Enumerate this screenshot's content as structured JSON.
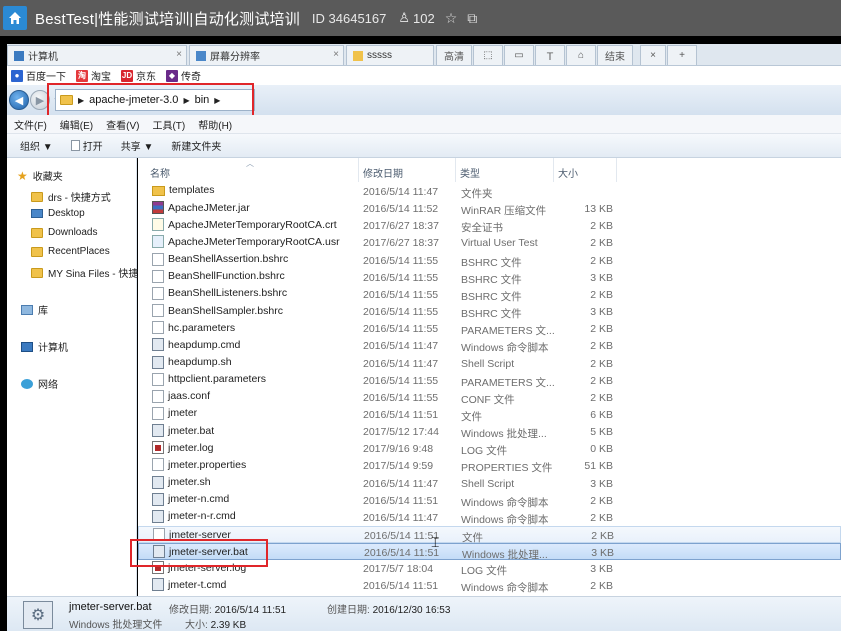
{
  "stream": {
    "title": "BestTest|性能测试培训|自动化测试培训",
    "room_id": "ID 34645167",
    "viewers": "102"
  },
  "browser": {
    "tabs": [
      {
        "label": "计算机"
      },
      {
        "label": "屏幕分辨率"
      },
      {
        "label": "sssss"
      }
    ],
    "tab_buttons": [
      "高清",
      "结束"
    ],
    "favorites": [
      "百度一下",
      "淘宝",
      "京东",
      "传奇"
    ]
  },
  "address": {
    "path": [
      "apache-jmeter-3.0",
      "bin"
    ]
  },
  "menu": [
    "文件(F)",
    "编辑(E)",
    "查看(V)",
    "工具(T)",
    "帮助(H)"
  ],
  "commands": [
    "组织 ▼",
    "打开",
    "共享 ▼",
    "新建文件夹"
  ],
  "nav": {
    "favorites_label": "收藏夹",
    "favorites": [
      "drs - 快捷方式",
      "Desktop",
      "Downloads",
      "RecentPlaces",
      "MY Sina Files - 快捷"
    ],
    "library": "库",
    "computer": "计算机",
    "network": "网络"
  },
  "columns": {
    "name": "名称",
    "date": "修改日期",
    "type": "类型",
    "size": "大小"
  },
  "files": [
    {
      "name": "templates",
      "date": "2016/5/14 11:47",
      "type": "文件夹",
      "size": "",
      "icon": "folder"
    },
    {
      "name": "ApacheJMeter.jar",
      "date": "2016/5/14 11:52",
      "type": "WinRAR 压缩文件",
      "size": "13 KB",
      "icon": "jar"
    },
    {
      "name": "ApacheJMeterTemporaryRootCA.crt",
      "date": "2017/6/27 18:37",
      "type": "安全证书",
      "size": "2 KB",
      "icon": "cert"
    },
    {
      "name": "ApacheJMeterTemporaryRootCA.usr",
      "date": "2017/6/27 18:37",
      "type": "Virtual User Test",
      "size": "2 KB",
      "icon": "usr"
    },
    {
      "name": "BeanShellAssertion.bshrc",
      "date": "2016/5/14 11:55",
      "type": "BSHRC 文件",
      "size": "2 KB",
      "icon": "blank"
    },
    {
      "name": "BeanShellFunction.bshrc",
      "date": "2016/5/14 11:55",
      "type": "BSHRC 文件",
      "size": "3 KB",
      "icon": "blank"
    },
    {
      "name": "BeanShellListeners.bshrc",
      "date": "2016/5/14 11:55",
      "type": "BSHRC 文件",
      "size": "2 KB",
      "icon": "blank"
    },
    {
      "name": "BeanShellSampler.bshrc",
      "date": "2016/5/14 11:55",
      "type": "BSHRC 文件",
      "size": "3 KB",
      "icon": "blank"
    },
    {
      "name": "hc.parameters",
      "date": "2016/5/14 11:55",
      "type": "PARAMETERS 文...",
      "size": "2 KB",
      "icon": "blank"
    },
    {
      "name": "heapdump.cmd",
      "date": "2016/5/14 11:47",
      "type": "Windows 命令脚本",
      "size": "2 KB",
      "icon": "bat"
    },
    {
      "name": "heapdump.sh",
      "date": "2016/5/14 11:47",
      "type": "Shell Script",
      "size": "2 KB",
      "icon": "bat"
    },
    {
      "name": "httpclient.parameters",
      "date": "2016/5/14 11:55",
      "type": "PARAMETERS 文...",
      "size": "2 KB",
      "icon": "blank"
    },
    {
      "name": "jaas.conf",
      "date": "2016/5/14 11:55",
      "type": "CONF 文件",
      "size": "2 KB",
      "icon": "blank"
    },
    {
      "name": "jmeter",
      "date": "2016/5/14 11:51",
      "type": "文件",
      "size": "6 KB",
      "icon": "blank"
    },
    {
      "name": "jmeter.bat",
      "date": "2017/5/12 17:44",
      "type": "Windows 批处理...",
      "size": "5 KB",
      "icon": "bat"
    },
    {
      "name": "jmeter.log",
      "date": "2017/9/16 9:48",
      "type": "LOG 文件",
      "size": "0 KB",
      "icon": "log"
    },
    {
      "name": "jmeter.properties",
      "date": "2017/5/14 9:59",
      "type": "PROPERTIES 文件",
      "size": "51 KB",
      "icon": "blank"
    },
    {
      "name": "jmeter.sh",
      "date": "2016/5/14 11:47",
      "type": "Shell Script",
      "size": "3 KB",
      "icon": "bat"
    },
    {
      "name": "jmeter-n.cmd",
      "date": "2016/5/14 11:51",
      "type": "Windows 命令脚本",
      "size": "2 KB",
      "icon": "bat"
    },
    {
      "name": "jmeter-n-r.cmd",
      "date": "2016/5/14 11:47",
      "type": "Windows 命令脚本",
      "size": "2 KB",
      "icon": "bat"
    },
    {
      "name": "jmeter-server",
      "date": "2016/5/14 11:51",
      "type": "文件",
      "size": "2 KB",
      "icon": "blank"
    },
    {
      "name": "jmeter-server.bat",
      "date": "2016/5/14 11:51",
      "type": "Windows 批处理...",
      "size": "3 KB",
      "icon": "bat"
    },
    {
      "name": "jmeter-server.log",
      "date": "2017/5/7 18:04",
      "type": "LOG 文件",
      "size": "3 KB",
      "icon": "log"
    },
    {
      "name": "jmeter-t.cmd",
      "date": "2016/5/14 11:51",
      "type": "Windows 命令脚本",
      "size": "2 KB",
      "icon": "bat"
    }
  ],
  "hovered_index": 20,
  "selected_index": 21,
  "details": {
    "name": "jmeter-server.bat",
    "type": "Windows 批处理文件",
    "modified_label": "修改日期:",
    "modified": "2016/5/14 11:51",
    "size_label": "大小:",
    "size": "2.39 KB",
    "created_label": "创建日期:",
    "created": "2016/12/30 16:53"
  }
}
